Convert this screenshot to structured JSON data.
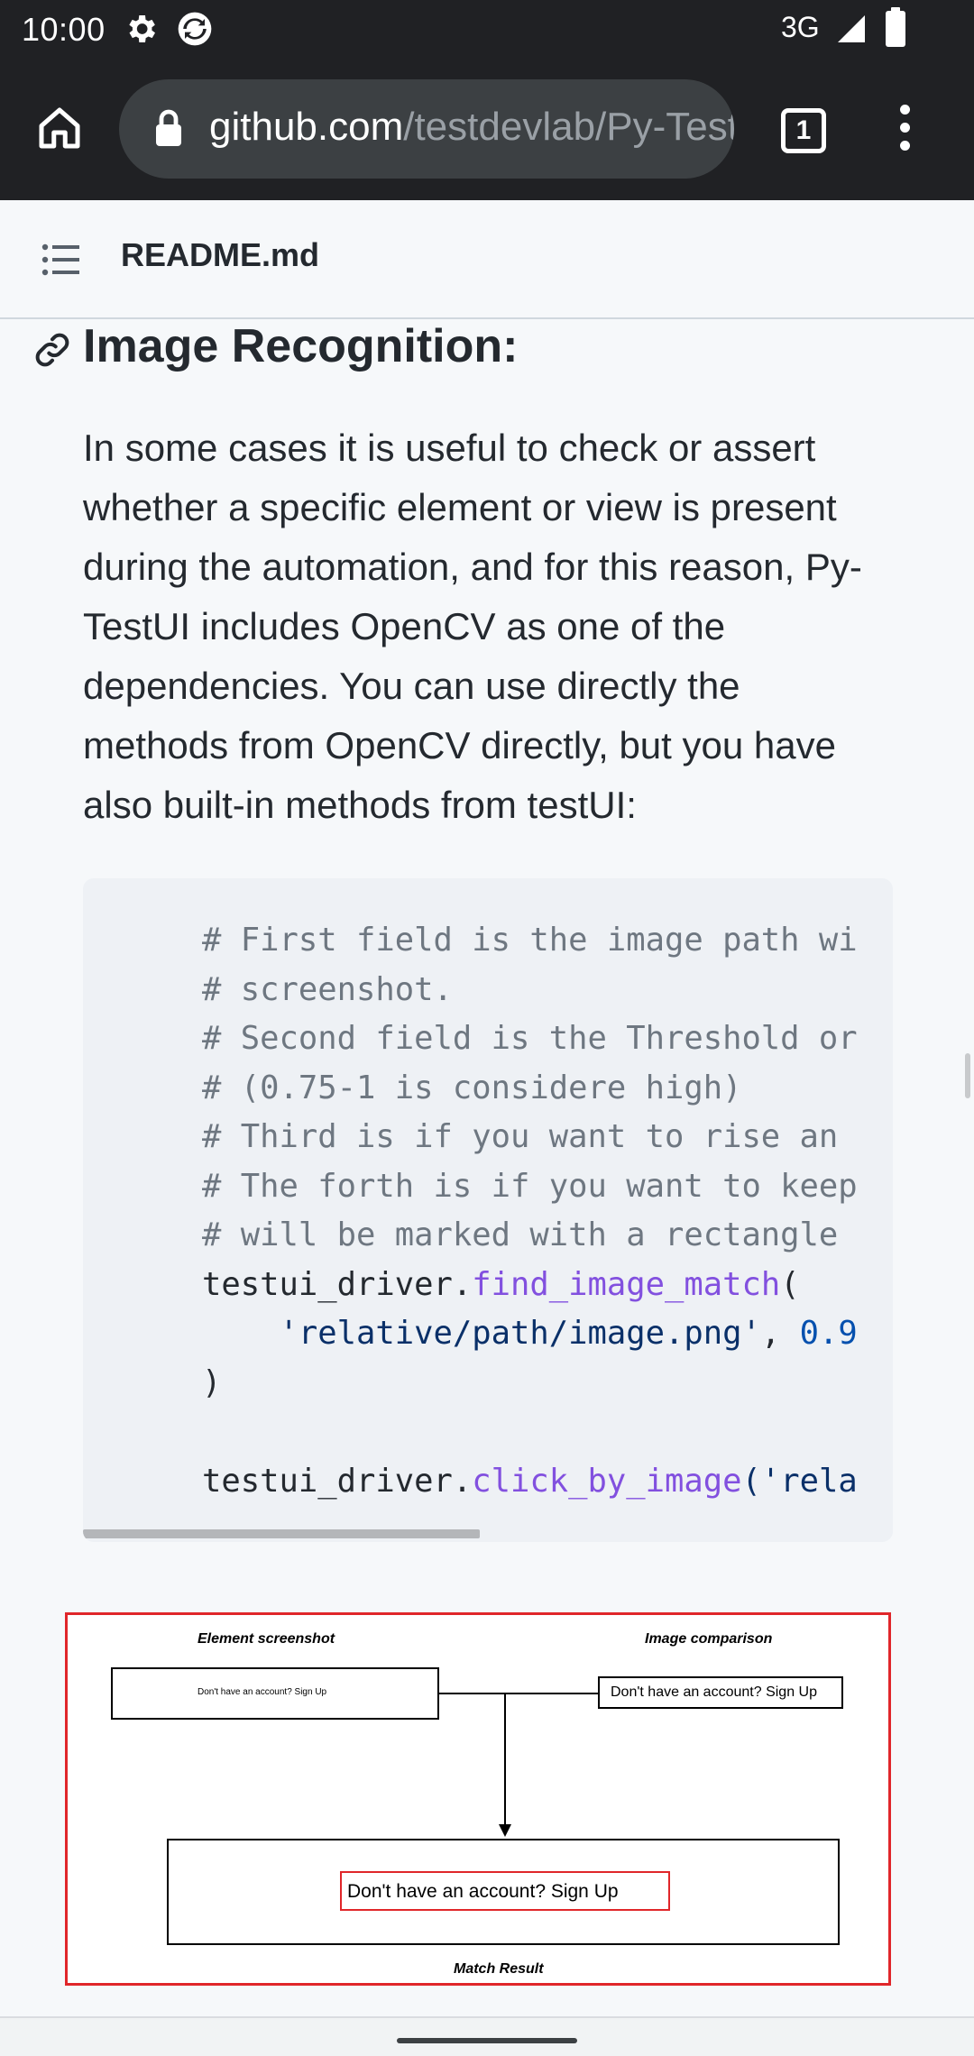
{
  "status_bar": {
    "time": "10:00",
    "network": "3G",
    "icons": [
      "gear-icon",
      "sync-icon",
      "signal-icon",
      "battery-icon"
    ]
  },
  "browser": {
    "url_host": "github.com",
    "url_path": "/testdevlab/Py-TestUI",
    "tab_count": "1",
    "icons": [
      "home-icon",
      "lock-icon",
      "tab-switcher-icon",
      "more-vert-icon"
    ]
  },
  "file_header": {
    "title": "README.md",
    "icon": "list-icon"
  },
  "section": {
    "heading": "Image Recognition:",
    "icon": "link-icon",
    "paragraph": "In some cases it is useful to check or assert whether a specific element or view is present during the automation, and for this reason, Py-TestUI includes OpenCV as one of the dependencies. You can use directly the methods from OpenCV directly, but you have also built-in methods from testUI:"
  },
  "code": {
    "lines": [
      "# First field is the image path wi",
      "# screenshot.",
      "# Second field is the Threshold or",
      "# (0.75-1 is considere high)",
      "# Third is if you want to rise an",
      "# The forth is if you want to keep",
      "# will be marked with a rectangle",
      "testui_driver.",
      "find_image_match",
      "(",
      "'relative/path/image.png'",
      ", ",
      "0.9",
      ")",
      "testui_driver.",
      "click_by_image",
      "('rela"
    ]
  },
  "diagram": {
    "caption_left": "Element screenshot",
    "caption_right": "Image comparison",
    "element_text": "Don't have an account? Sign Up",
    "comparison_text": "Don't have an account? Sign Up",
    "result_text": "Don't have an account? Sign Up",
    "caption_bottom": "Match Result"
  },
  "colors": {
    "chrome_dark": "#202124",
    "url_bar": "#3c4043",
    "code_bg": "#eef1f5",
    "comment": "#6e7781",
    "function": "#8250df",
    "string": "#0a3069",
    "number": "#0550ae",
    "match_red": "#e0262a"
  }
}
